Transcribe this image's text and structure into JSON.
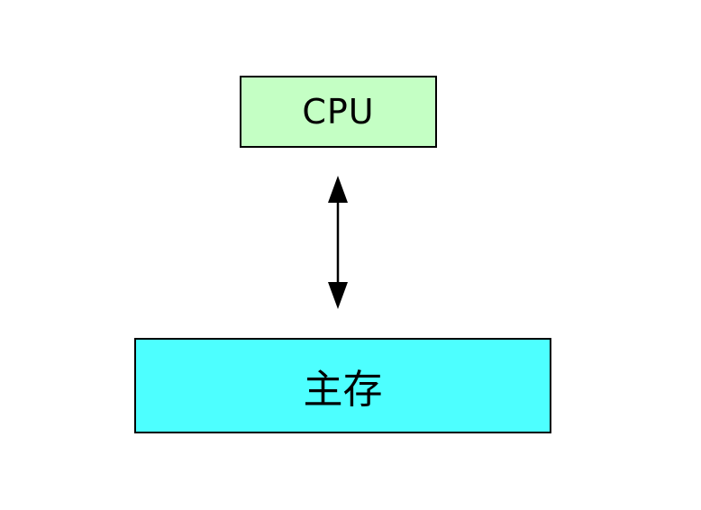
{
  "diagram": {
    "cpu": {
      "label": "CPU",
      "fill": "#c4ffc4"
    },
    "memory": {
      "label": "主存",
      "fill": "#4dffff"
    },
    "connector": {
      "direction": "bidirectional",
      "color": "#000000"
    }
  }
}
